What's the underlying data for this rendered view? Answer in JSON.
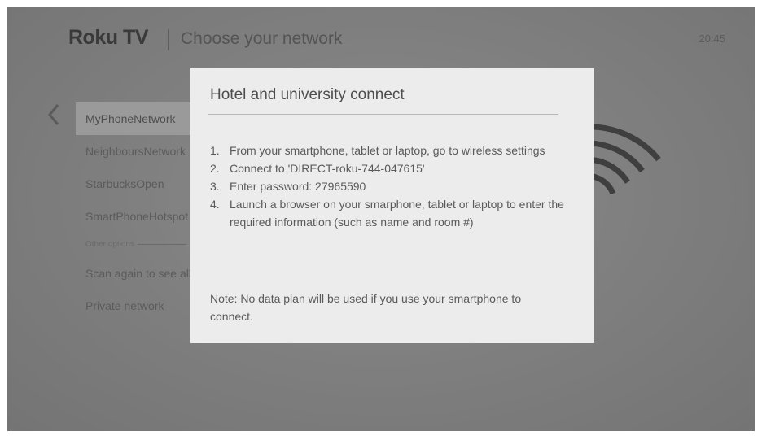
{
  "header": {
    "logo": "Roku TV",
    "title": "Choose your network",
    "clock": "20:45"
  },
  "networks": [
    {
      "label": "MyPhoneNetwork",
      "selected": true
    },
    {
      "label": "NeighboursNetwork",
      "selected": false
    },
    {
      "label": "StarbucksOpen",
      "selected": false
    },
    {
      "label": "SmartPhoneHotspot",
      "selected": false
    },
    {
      "label": "Other options",
      "divider": true
    },
    {
      "label": "Scan again to see all networks",
      "selected": false
    },
    {
      "label": "Private network",
      "selected": false
    }
  ],
  "dialog": {
    "title": "Hotel and university connect",
    "steps": [
      {
        "num": "1.",
        "text": "From your smartphone, tablet or laptop, go to wireless settings"
      },
      {
        "num": "2.",
        "text": "Connect to 'DIRECT-roku-744-047615'"
      },
      {
        "num": "3.",
        "text": "Enter password: 27965590"
      },
      {
        "num": "4.",
        "text": "Launch a browser on your smarphone, tablet or laptop to enter the required information (such as name and room #)"
      }
    ],
    "note": "Note: No data plan will be used if you use your smartphone to connect."
  }
}
